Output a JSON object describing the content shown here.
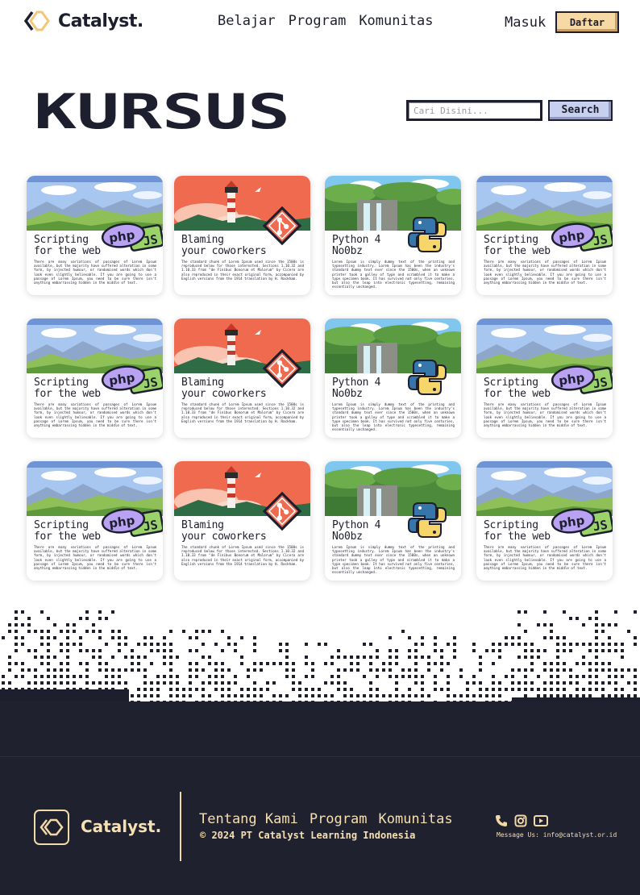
{
  "header": {
    "brand": "Catalyst.",
    "nav": [
      "Belajar",
      "Program",
      "Komunitas"
    ],
    "login": "Masuk",
    "register": "Daftar"
  },
  "hero": {
    "title": "KURSUS",
    "search_placeholder": "Cari Disini...",
    "search_button": "Search"
  },
  "courses": {
    "php": {
      "title": "Scripting\nfor the web",
      "desc": "There are many variations of passages of Lorem Ipsum available, but the majority have suffered alteration in some form, by injected humour, or randomised words which don't look even slightly believable. If you are going to use a passage of Lorem Ipsum, you need to be sure there isn't anything embarrassing hidden in the middle of text."
    },
    "git": {
      "title": "Blaming\nyour coworkers",
      "desc": "The standard chunk of Lorem Ipsum used since the 1500s is reproduced below for those interested. Sections 1.10.32 and 1.10.33 from \"de Finibus Bonorum et Malorum\" by Cicero are also reproduced in their exact original form, accompanied by English versions from the 1914 translation by H. Rackham."
    },
    "python": {
      "title": "Python 4\nNo0bz",
      "desc": "Lorem Ipsum is simply dummy text of the printing and typesetting industry. Lorem Ipsum has been the industry's standard dummy text ever since the 1500s, when an unknown printer took a galley of type and scrambled it to make a type specimen book. It has survived not only five centuries, but also the leap into electronic typesetting, remaining essentially unchanged."
    }
  },
  "footer": {
    "brand": "Catalyst.",
    "links": [
      "Tentang Kami",
      "Program",
      "Komunitas"
    ],
    "copyright": "© 2024 PT Catalyst Learning Indonesia",
    "contact": "Message Us: info@catalyst.or.id",
    "social_icons": [
      "phone-icon",
      "instagram-icon",
      "youtube-icon"
    ]
  },
  "colors": {
    "dark": "#1e1f2e",
    "cream": "#f6dfb1",
    "daftar_bg": "#f6d9a4",
    "search_bg": "#c8d0ef"
  }
}
